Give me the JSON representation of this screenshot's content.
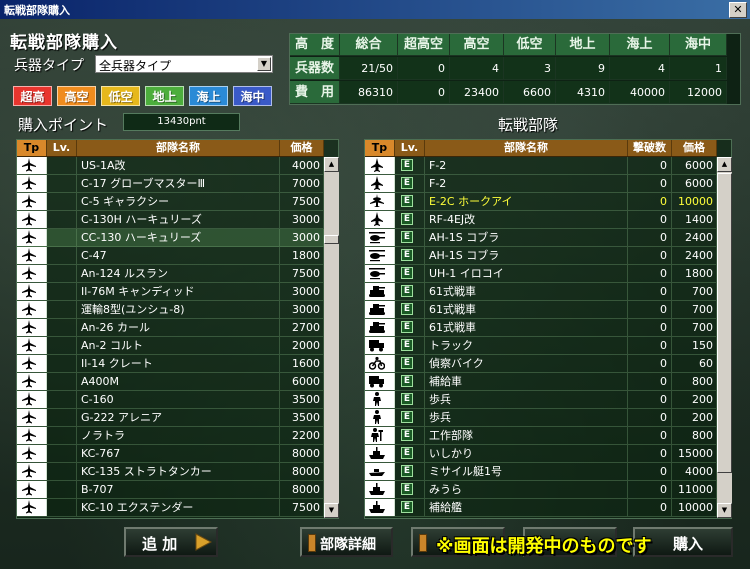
{
  "window": {
    "title": "転戦部隊購入",
    "close_label": "✕"
  },
  "header": {
    "title": "転戦部隊購入",
    "weapon_type_label": "兵器タイプ",
    "weapon_type_value": "全兵器タイプ"
  },
  "filters": [
    {
      "label": "超高",
      "color": "#e8352e"
    },
    {
      "label": "高空",
      "color": "#f08c1e"
    },
    {
      "label": "低空",
      "color": "#e6b81c"
    },
    {
      "label": "地上",
      "color": "#4cae3c"
    },
    {
      "label": "海上",
      "color": "#2a8ad6"
    },
    {
      "label": "海中",
      "color": "#3a5ac8"
    }
  ],
  "stats": {
    "corner": "高　度",
    "columns": [
      "総合",
      "超高空",
      "高空",
      "低空",
      "地上",
      "海上",
      "海中"
    ],
    "rows": [
      {
        "label": "兵器数",
        "values": [
          "21/50",
          "0",
          "4",
          "3",
          "9",
          "4",
          "1"
        ]
      },
      {
        "label": "費　用",
        "values": [
          "86310",
          "0",
          "23400",
          "6600",
          "4310",
          "40000",
          "12000"
        ]
      }
    ]
  },
  "points": {
    "label": "購入ポイント",
    "value": "13430pnt"
  },
  "left_list": {
    "headers": {
      "tp": "Tp",
      "lv": "Lv.",
      "name": "部隊名称",
      "price": "価格"
    },
    "rows": [
      {
        "icon": "plane",
        "name": "US-1A改",
        "price": "4000"
      },
      {
        "icon": "plane",
        "name": "C-17 グローブマスターⅢ",
        "price": "7000"
      },
      {
        "icon": "plane",
        "name": "C-5 ギャラクシー",
        "price": "7500"
      },
      {
        "icon": "plane",
        "name": "C-130H ハーキュリーズ",
        "price": "3000"
      },
      {
        "icon": "plane",
        "name": "CC-130 ハーキュリーズ",
        "price": "3000"
      },
      {
        "icon": "plane",
        "name": "C-47",
        "price": "1800"
      },
      {
        "icon": "plane",
        "name": "An-124 ルスラン",
        "price": "7500"
      },
      {
        "icon": "plane",
        "name": "Il-76M キャンディッド",
        "price": "3000"
      },
      {
        "icon": "plane",
        "name": "運輸8型(ユンシュ-8)",
        "price": "3000"
      },
      {
        "icon": "plane",
        "name": "An-26 カール",
        "price": "2700"
      },
      {
        "icon": "plane",
        "name": "An-2 コルト",
        "price": "2000"
      },
      {
        "icon": "plane",
        "name": "Il-14 クレート",
        "price": "1600"
      },
      {
        "icon": "plane",
        "name": "A400M",
        "price": "6000"
      },
      {
        "icon": "plane",
        "name": "C-160",
        "price": "3500"
      },
      {
        "icon": "plane",
        "name": "G-222 アレニア",
        "price": "3500"
      },
      {
        "icon": "plane",
        "name": "ノラトラ",
        "price": "2200"
      },
      {
        "icon": "plane",
        "name": "KC-767",
        "price": "8000"
      },
      {
        "icon": "plane",
        "name": "KC-135 ストラトタンカー",
        "price": "8000"
      },
      {
        "icon": "plane",
        "name": "B-707",
        "price": "8000"
      },
      {
        "icon": "plane",
        "name": "KC-10 エクステンダー",
        "price": "7500"
      }
    ]
  },
  "right_list": {
    "title": "転戦部隊",
    "headers": {
      "tp": "Tp",
      "lv": "Lv.",
      "name": "部隊名称",
      "kills": "撃破数",
      "price": "価格"
    },
    "rows": [
      {
        "icon": "jet",
        "lv": "E",
        "name": "F-2",
        "kills": "0",
        "price": "6000"
      },
      {
        "icon": "jet",
        "lv": "E",
        "name": "F-2",
        "kills": "0",
        "price": "6000"
      },
      {
        "icon": "awacs",
        "lv": "E",
        "name": "E-2C ホークアイ",
        "kills": "0",
        "price": "10000"
      },
      {
        "icon": "jet",
        "lv": "E",
        "name": "RF-4EJ改",
        "kills": "0",
        "price": "1400"
      },
      {
        "icon": "heli",
        "lv": "E",
        "name": "AH-1S コブラ",
        "kills": "0",
        "price": "2400"
      },
      {
        "icon": "heli",
        "lv": "E",
        "name": "AH-1S コブラ",
        "kills": "0",
        "price": "2400"
      },
      {
        "icon": "heli",
        "lv": "E",
        "name": "UH-1 イロコイ",
        "kills": "0",
        "price": "1800"
      },
      {
        "icon": "tank",
        "lv": "E",
        "name": "61式戦車",
        "kills": "0",
        "price": "700"
      },
      {
        "icon": "tank",
        "lv": "E",
        "name": "61式戦車",
        "kills": "0",
        "price": "700"
      },
      {
        "icon": "tank",
        "lv": "E",
        "name": "61式戦車",
        "kills": "0",
        "price": "700"
      },
      {
        "icon": "truck",
        "lv": "E",
        "name": "トラック",
        "kills": "0",
        "price": "150"
      },
      {
        "icon": "bike",
        "lv": "E",
        "name": "偵察バイク",
        "kills": "0",
        "price": "60"
      },
      {
        "icon": "truck",
        "lv": "E",
        "name": "補給車",
        "kills": "0",
        "price": "800"
      },
      {
        "icon": "soldier",
        "lv": "E",
        "name": "歩兵",
        "kills": "0",
        "price": "200"
      },
      {
        "icon": "soldier",
        "lv": "E",
        "name": "歩兵",
        "kills": "0",
        "price": "200"
      },
      {
        "icon": "engineer",
        "lv": "E",
        "name": "工作部隊",
        "kills": "0",
        "price": "800"
      },
      {
        "icon": "ship",
        "lv": "E",
        "name": "いしかり",
        "kills": "0",
        "price": "15000"
      },
      {
        "icon": "boat",
        "lv": "E",
        "name": "ミサイル艇1号",
        "kills": "0",
        "price": "4000"
      },
      {
        "icon": "ship",
        "lv": "E",
        "name": "みうら",
        "kills": "0",
        "price": "11000"
      },
      {
        "icon": "ship",
        "lv": "E",
        "name": "補給艦",
        "kills": "0",
        "price": "10000"
      }
    ]
  },
  "buttons": {
    "add": "追 加",
    "detail": "部隊詳細",
    "partial": "購入"
  },
  "notice": "※画面は開発中のものです"
}
